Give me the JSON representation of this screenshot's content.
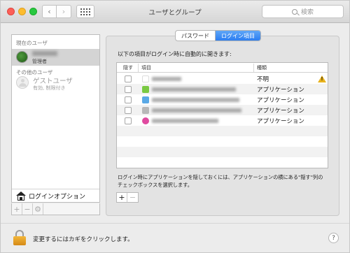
{
  "window": {
    "title": "ユーザとグループ"
  },
  "toolbar": {
    "search_placeholder": "検索",
    "back_icon": "chevron-left-icon",
    "forward_icon": "chevron-right-icon",
    "grid_icon": "show-all-grid-icon"
  },
  "sidebar": {
    "current_user_header": "現在のユーザ",
    "current_user": {
      "role": "管理者"
    },
    "other_users_header": "その他のユーザ",
    "guest_user": {
      "name": "ゲストユーザ",
      "status": "有効, 制限付き"
    },
    "login_options_label": "ログインオプション"
  },
  "tabs": [
    {
      "label": "パスワード",
      "active": false
    },
    {
      "label": "ログイン項目",
      "active": true
    }
  ],
  "login_items": {
    "instruction": "以下の項目がログイン時に自動的に開きます:",
    "columns": {
      "hide": "隠す",
      "item": "項目",
      "kind": "種類"
    },
    "rows": [
      {
        "kind": "不明",
        "icon_color": "#ffffff",
        "warning": true
      },
      {
        "kind": "アプリケーション",
        "icon_color": "#7ac943",
        "warning": false
      },
      {
        "kind": "アプリケーション",
        "icon_color": "#5aa9e6",
        "warning": false
      },
      {
        "kind": "アプリケーション",
        "icon_color": "#b8b8b8",
        "warning": false
      },
      {
        "kind": "アプリケーション",
        "icon_color": "#e04aa0",
        "warning": false
      }
    ],
    "note": "ログイン時にアプリケーションを隠しておくには、アプリケーションの横にある\"隠す\"列のチェックボックスを選択します。",
    "add_label": "+",
    "remove_label": "−"
  },
  "footer": {
    "lock_text": "変更するにはカギをクリックします。",
    "help_label": "?"
  }
}
